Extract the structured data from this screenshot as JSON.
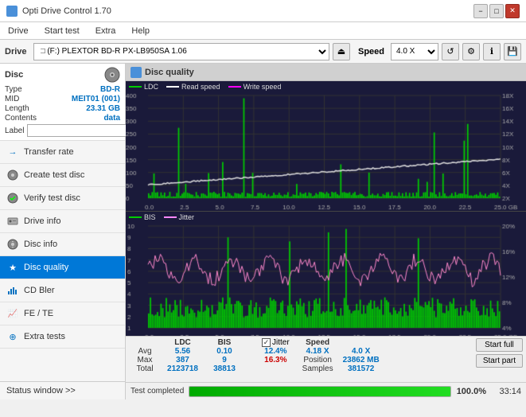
{
  "titleBar": {
    "title": "Opti Drive Control 1.70",
    "minimize": "−",
    "maximize": "□",
    "close": "✕"
  },
  "menuBar": {
    "items": [
      "Drive",
      "Start test",
      "Extra",
      "Help"
    ]
  },
  "driveToolbar": {
    "driveLabel": "Drive",
    "driveValue": "(F:)  PLEXTOR BD-R  PX-LB950SA 1.06",
    "speedLabel": "Speed",
    "speedValue": "4.0 X"
  },
  "discPanel": {
    "title": "Disc",
    "fields": [
      {
        "label": "Type",
        "value": "BD-R"
      },
      {
        "label": "MID",
        "value": "MEIT01 (001)"
      },
      {
        "label": "Length",
        "value": "23.31 GB"
      },
      {
        "label": "Contents",
        "value": "data"
      }
    ],
    "labelField": "Label"
  },
  "navItems": [
    {
      "id": "transfer-rate",
      "label": "Transfer rate",
      "icon": "→"
    },
    {
      "id": "create-test-disc",
      "label": "Create test disc",
      "icon": "💿"
    },
    {
      "id": "verify-test-disc",
      "label": "Verify test disc",
      "icon": "✓"
    },
    {
      "id": "drive-info",
      "label": "Drive info",
      "icon": "ℹ"
    },
    {
      "id": "disc-info",
      "label": "Disc info",
      "icon": "📀"
    },
    {
      "id": "disc-quality",
      "label": "Disc quality",
      "icon": "★",
      "active": true
    },
    {
      "id": "cd-bler",
      "label": "CD Bler",
      "icon": "📊"
    },
    {
      "id": "fe-te",
      "label": "FE / TE",
      "icon": "📈"
    },
    {
      "id": "extra-tests",
      "label": "Extra tests",
      "icon": "⊕"
    }
  ],
  "statusWindow": {
    "label": "Status window >>"
  },
  "chartSection": {
    "title": "Disc quality",
    "legend1": {
      "items": [
        {
          "label": "LDC",
          "color": "#00cc00"
        },
        {
          "label": "Read speed",
          "color": "#ffffff"
        },
        {
          "label": "Write speed",
          "color": "#ff00ff"
        }
      ]
    },
    "legend2": {
      "items": [
        {
          "label": "BIS",
          "color": "#00cc00"
        },
        {
          "label": "Jitter",
          "color": "#ff88ff"
        }
      ]
    },
    "yAxis1": {
      "max": "400",
      "labels": [
        "400",
        "350",
        "300",
        "250",
        "200",
        "150",
        "100",
        "50",
        "0"
      ],
      "right": [
        "18X",
        "16X",
        "14X",
        "12X",
        "10X",
        "8X",
        "6X",
        "4X",
        "2X"
      ]
    },
    "yAxis2": {
      "max": "10",
      "labels": [
        "10",
        "9",
        "8",
        "7",
        "6",
        "5",
        "4",
        "3",
        "2",
        "1"
      ],
      "right": [
        "20%",
        "16%",
        "12%",
        "8%",
        "4%"
      ]
    },
    "xAxis": {
      "labels": [
        "0.0",
        "2.5",
        "5.0",
        "7.5",
        "10.0",
        "12.5",
        "15.0",
        "17.5",
        "20.0",
        "22.5",
        "25.0 GB"
      ]
    }
  },
  "statsBar": {
    "headers": [
      "LDC",
      "BIS",
      "",
      "Jitter",
      "Speed",
      ""
    ],
    "avg": {
      "ldc": "5.56",
      "bis": "0.10",
      "jitter": "12.4%"
    },
    "max": {
      "ldc": "387",
      "bis": "9",
      "jitter": "16.3%"
    },
    "total": {
      "ldc": "2123718",
      "bis": "38813"
    },
    "speed": {
      "current": "4.18 X",
      "setting": "4.0 X"
    },
    "position": "23862 MB",
    "samples": "381572",
    "jitterChecked": true
  },
  "actionButtons": {
    "startFull": "Start full",
    "startPart": "Start part"
  },
  "progressBar": {
    "value": 100,
    "text": "100.0%",
    "time": "33:14"
  },
  "statusText": "Test completed"
}
